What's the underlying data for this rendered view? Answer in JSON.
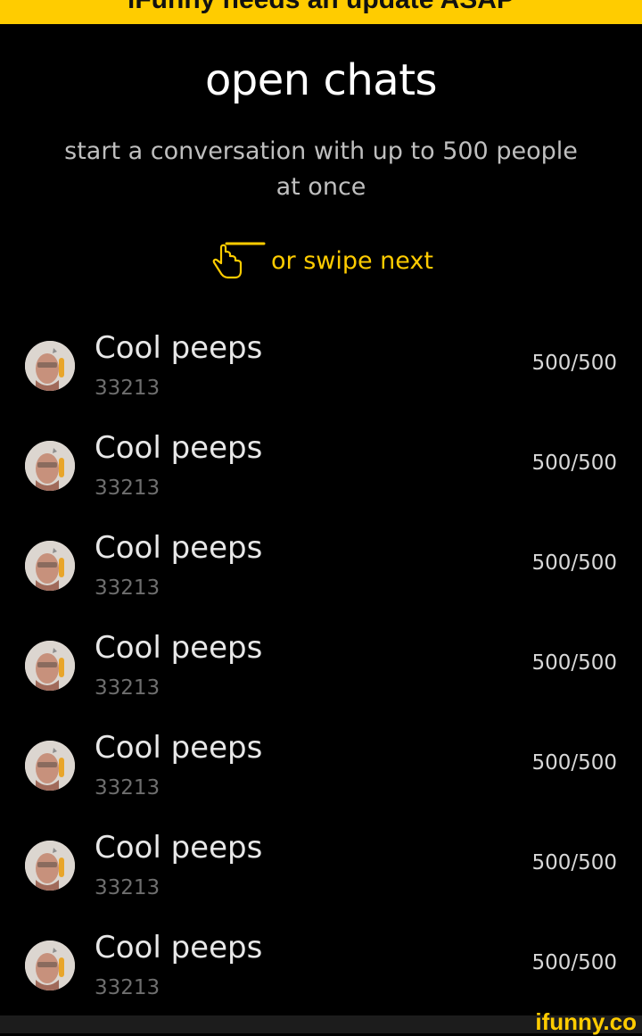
{
  "banner": {
    "text": "iFunny needs an update ASAP"
  },
  "header": {
    "title": "open chats",
    "subtitle": "start a conversation with up to 500 people at once"
  },
  "swipe_hint": {
    "icon": "hand-swipe-icon",
    "text": "or swipe next"
  },
  "chats": [
    {
      "name": "Cool peeps",
      "id": "33213",
      "members": "500/500",
      "avatar": "avatar-photo"
    },
    {
      "name": "Cool peeps",
      "id": "33213",
      "members": "500/500",
      "avatar": "avatar-photo"
    },
    {
      "name": "Cool peeps",
      "id": "33213",
      "members": "500/500",
      "avatar": "avatar-photo"
    },
    {
      "name": "Cool peeps",
      "id": "33213",
      "members": "500/500",
      "avatar": "avatar-photo"
    },
    {
      "name": "Cool peeps",
      "id": "33213",
      "members": "500/500",
      "avatar": "avatar-photo"
    },
    {
      "name": "Cool peeps",
      "id": "33213",
      "members": "500/500",
      "avatar": "avatar-photo"
    },
    {
      "name": "Cool peeps",
      "id": "33213",
      "members": "500/500",
      "avatar": "avatar-photo"
    }
  ],
  "watermark": "ifunny.co",
  "colors": {
    "accent": "#ffcc00",
    "background": "#000000",
    "text_primary": "#ffffff",
    "text_secondary": "#bfbfbf",
    "text_muted": "#6e6e6e"
  }
}
